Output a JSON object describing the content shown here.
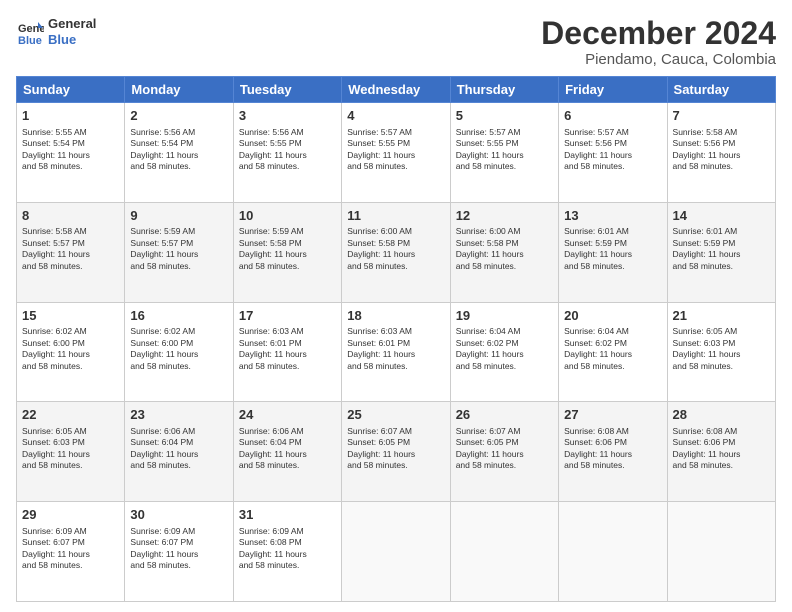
{
  "logo": {
    "line1": "General",
    "line2": "Blue"
  },
  "title": "December 2024",
  "subtitle": "Piendamo, Cauca, Colombia",
  "days_of_week": [
    "Sunday",
    "Monday",
    "Tuesday",
    "Wednesday",
    "Thursday",
    "Friday",
    "Saturday"
  ],
  "weeks": [
    [
      {
        "day": 1,
        "sunrise": "5:55 AM",
        "sunset": "5:54 PM",
        "daylight": "11 hours and 58 minutes."
      },
      {
        "day": 2,
        "sunrise": "5:56 AM",
        "sunset": "5:54 PM",
        "daylight": "11 hours and 58 minutes."
      },
      {
        "day": 3,
        "sunrise": "5:56 AM",
        "sunset": "5:55 PM",
        "daylight": "11 hours and 58 minutes."
      },
      {
        "day": 4,
        "sunrise": "5:57 AM",
        "sunset": "5:55 PM",
        "daylight": "11 hours and 58 minutes."
      },
      {
        "day": 5,
        "sunrise": "5:57 AM",
        "sunset": "5:55 PM",
        "daylight": "11 hours and 58 minutes."
      },
      {
        "day": 6,
        "sunrise": "5:57 AM",
        "sunset": "5:56 PM",
        "daylight": "11 hours and 58 minutes."
      },
      {
        "day": 7,
        "sunrise": "5:58 AM",
        "sunset": "5:56 PM",
        "daylight": "11 hours and 58 minutes."
      }
    ],
    [
      {
        "day": 8,
        "sunrise": "5:58 AM",
        "sunset": "5:57 PM",
        "daylight": "11 hours and 58 minutes."
      },
      {
        "day": 9,
        "sunrise": "5:59 AM",
        "sunset": "5:57 PM",
        "daylight": "11 hours and 58 minutes."
      },
      {
        "day": 10,
        "sunrise": "5:59 AM",
        "sunset": "5:58 PM",
        "daylight": "11 hours and 58 minutes."
      },
      {
        "day": 11,
        "sunrise": "6:00 AM",
        "sunset": "5:58 PM",
        "daylight": "11 hours and 58 minutes."
      },
      {
        "day": 12,
        "sunrise": "6:00 AM",
        "sunset": "5:58 PM",
        "daylight": "11 hours and 58 minutes."
      },
      {
        "day": 13,
        "sunrise": "6:01 AM",
        "sunset": "5:59 PM",
        "daylight": "11 hours and 58 minutes."
      },
      {
        "day": 14,
        "sunrise": "6:01 AM",
        "sunset": "5:59 PM",
        "daylight": "11 hours and 58 minutes."
      }
    ],
    [
      {
        "day": 15,
        "sunrise": "6:02 AM",
        "sunset": "6:00 PM",
        "daylight": "11 hours and 58 minutes."
      },
      {
        "day": 16,
        "sunrise": "6:02 AM",
        "sunset": "6:00 PM",
        "daylight": "11 hours and 58 minutes."
      },
      {
        "day": 17,
        "sunrise": "6:03 AM",
        "sunset": "6:01 PM",
        "daylight": "11 hours and 58 minutes."
      },
      {
        "day": 18,
        "sunrise": "6:03 AM",
        "sunset": "6:01 PM",
        "daylight": "11 hours and 58 minutes."
      },
      {
        "day": 19,
        "sunrise": "6:04 AM",
        "sunset": "6:02 PM",
        "daylight": "11 hours and 58 minutes."
      },
      {
        "day": 20,
        "sunrise": "6:04 AM",
        "sunset": "6:02 PM",
        "daylight": "11 hours and 58 minutes."
      },
      {
        "day": 21,
        "sunrise": "6:05 AM",
        "sunset": "6:03 PM",
        "daylight": "11 hours and 58 minutes."
      }
    ],
    [
      {
        "day": 22,
        "sunrise": "6:05 AM",
        "sunset": "6:03 PM",
        "daylight": "11 hours and 58 minutes."
      },
      {
        "day": 23,
        "sunrise": "6:06 AM",
        "sunset": "6:04 PM",
        "daylight": "11 hours and 58 minutes."
      },
      {
        "day": 24,
        "sunrise": "6:06 AM",
        "sunset": "6:04 PM",
        "daylight": "11 hours and 58 minutes."
      },
      {
        "day": 25,
        "sunrise": "6:07 AM",
        "sunset": "6:05 PM",
        "daylight": "11 hours and 58 minutes."
      },
      {
        "day": 26,
        "sunrise": "6:07 AM",
        "sunset": "6:05 PM",
        "daylight": "11 hours and 58 minutes."
      },
      {
        "day": 27,
        "sunrise": "6:08 AM",
        "sunset": "6:06 PM",
        "daylight": "11 hours and 58 minutes."
      },
      {
        "day": 28,
        "sunrise": "6:08 AM",
        "sunset": "6:06 PM",
        "daylight": "11 hours and 58 minutes."
      }
    ],
    [
      {
        "day": 29,
        "sunrise": "6:09 AM",
        "sunset": "6:07 PM",
        "daylight": "11 hours and 58 minutes."
      },
      {
        "day": 30,
        "sunrise": "6:09 AM",
        "sunset": "6:07 PM",
        "daylight": "11 hours and 58 minutes."
      },
      {
        "day": 31,
        "sunrise": "6:09 AM",
        "sunset": "6:08 PM",
        "daylight": "11 hours and 58 minutes."
      },
      null,
      null,
      null,
      null
    ]
  ]
}
